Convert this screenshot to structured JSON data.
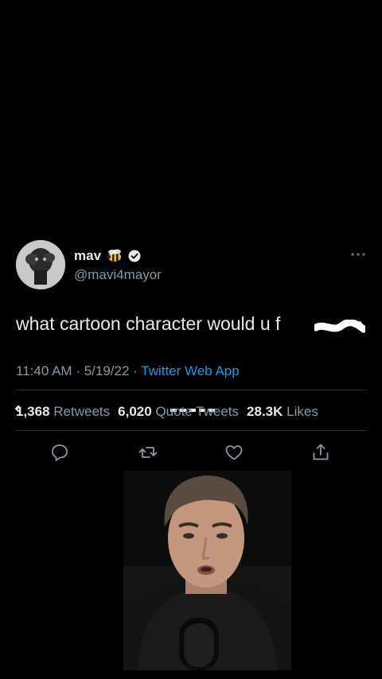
{
  "tweet": {
    "author": {
      "name": "mav",
      "handle": "@mavi4mayor",
      "verified": true,
      "emoji": "bee"
    },
    "text": "what cartoon character would u f",
    "redacted": true,
    "time": "11:40 AM",
    "date": "5/19/22",
    "source": "Twitter Web App",
    "stats": {
      "retweets_count": "1,368",
      "retweets_label": "Retweets",
      "quotes_count": "6,020",
      "quotes_label": "Quote Tweets",
      "likes_count": "28.3K",
      "likes_label": "Likes"
    },
    "actions": [
      "reply-icon",
      "retweet-icon",
      "like-icon",
      "share-icon"
    ]
  },
  "colors": {
    "background": "#000000",
    "text": "#e7e9ea",
    "muted": "#8b98a5",
    "accent": "#1d9bf0",
    "divider": "#2f3336"
  }
}
